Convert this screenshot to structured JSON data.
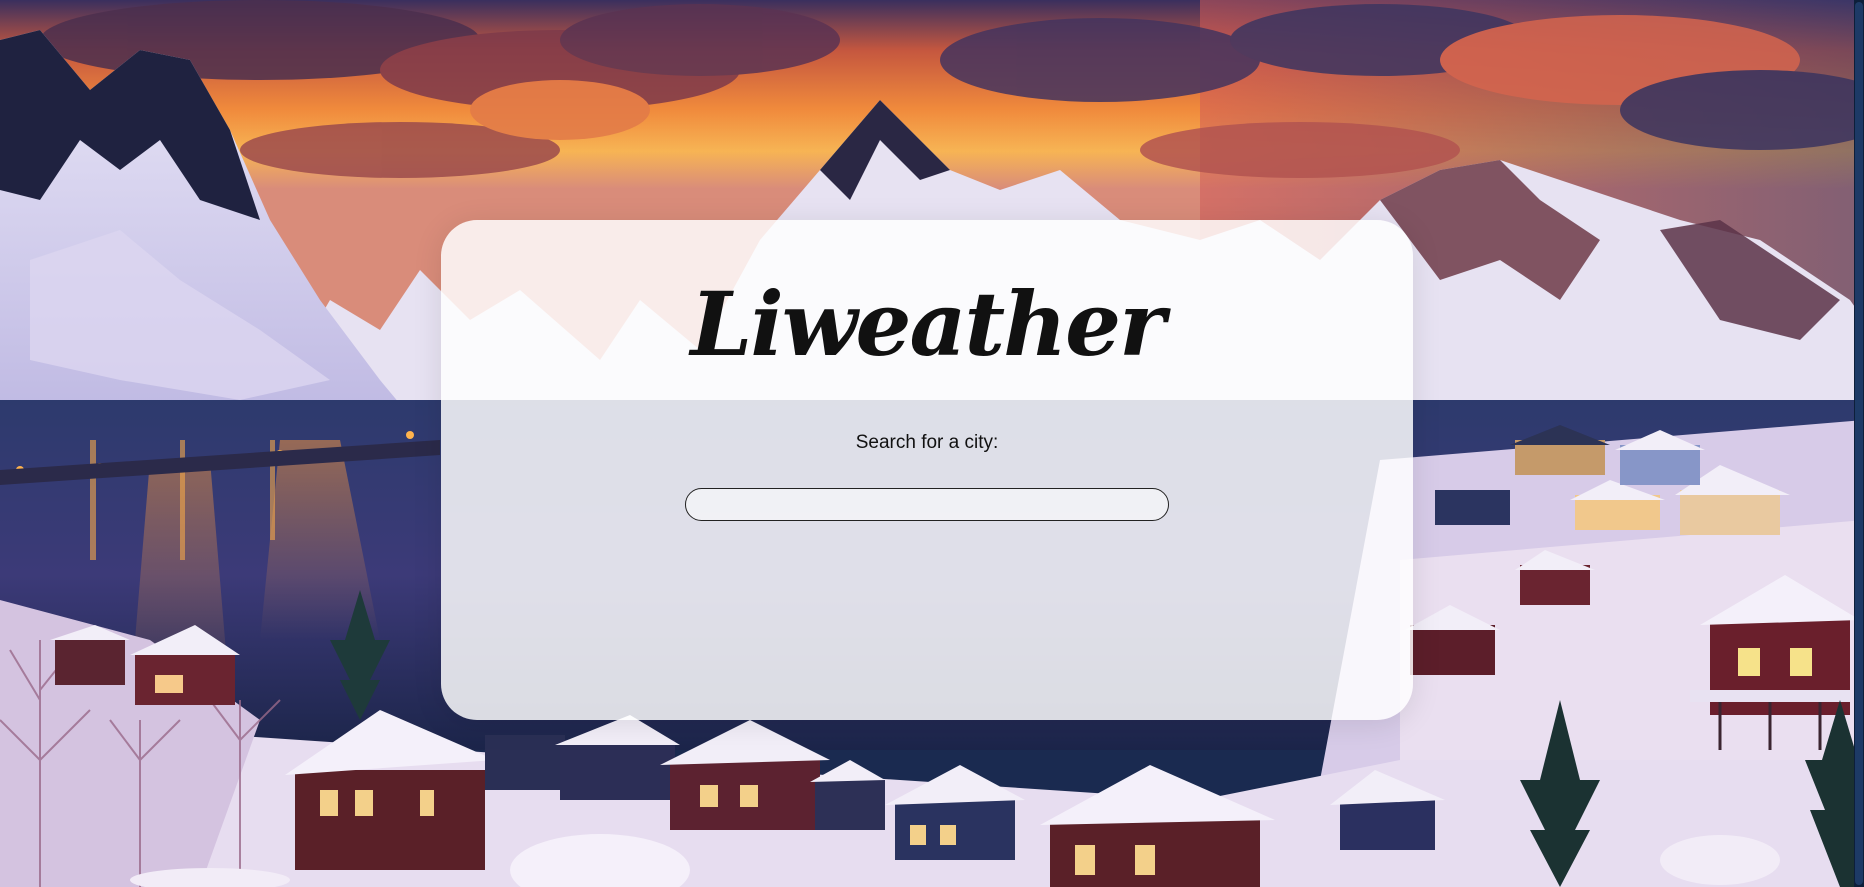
{
  "app": {
    "logo_text": "Liweather"
  },
  "search": {
    "label": "Search for a city:",
    "value": "",
    "placeholder": ""
  },
  "colors": {
    "card_background": "#ffffffd6",
    "text": "#111111",
    "input_border": "#222222"
  },
  "background": {
    "icon": "winter-village-landscape"
  }
}
